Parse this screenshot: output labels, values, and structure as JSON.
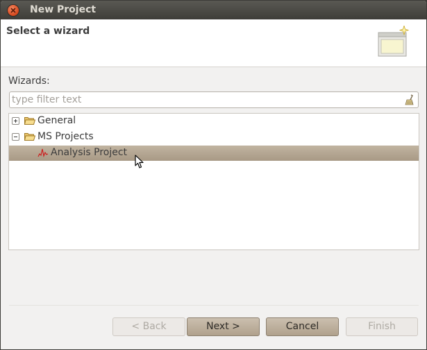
{
  "window": {
    "title": "New Project"
  },
  "header": {
    "title": "Select a wizard"
  },
  "wizards_label": "Wizards:",
  "filter": {
    "placeholder": "type filter text",
    "value": ""
  },
  "tree": {
    "items": [
      {
        "label": "General",
        "expanded": false
      },
      {
        "label": "MS Projects",
        "expanded": true
      },
      {
        "label": "Analysis Project",
        "selected": true
      }
    ]
  },
  "buttons": {
    "back": "< Back",
    "next": "Next >",
    "cancel": "Cancel",
    "finish": "Finish"
  },
  "colors": {
    "selection": "#b3a592",
    "titlebar": "#3c3b37",
    "close": "#df4a1f"
  }
}
